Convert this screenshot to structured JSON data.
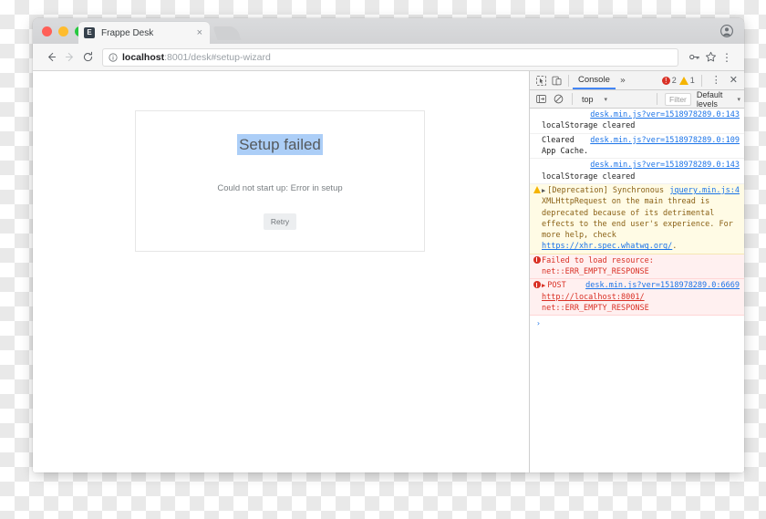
{
  "window": {
    "traffic_lights": [
      "close",
      "minimize",
      "maximize"
    ],
    "tab": {
      "favicon_letter": "E",
      "title": "Frappe Desk",
      "close_label": "×"
    },
    "toolbar": {
      "back_label": "←",
      "forward_label": "→",
      "reload_label": "↻",
      "omnibox_host": "localhost",
      "omnibox_rest": ":8001/desk#setup-wizard",
      "key_icon": "key-icon",
      "star_icon": "star-icon",
      "menu_label": "⋮"
    },
    "profile_icon": "profile-avatar-icon"
  },
  "page": {
    "title": "Setup failed",
    "message": "Could not start up: Error in setup",
    "retry_label": "Retry",
    "selection_color": "#accef7"
  },
  "devtools": {
    "tabbar": {
      "inspect_icon": "inspect-element-icon",
      "device_icon": "device-toolbar-icon",
      "tabs": [
        "Console"
      ],
      "active_tab": "Console",
      "more_label": "»",
      "error_count": "2",
      "warning_count": "1",
      "kebab_label": "⋮",
      "close_label": "✕"
    },
    "filterbar": {
      "sidebar_icon": "console-sidebar-icon",
      "clear_icon": "clear-console-icon",
      "context": "top",
      "filter_placeholder": "Filter",
      "levels": "Default levels",
      "caret": "▾"
    },
    "console": {
      "prompt": "›",
      "entries": [
        {
          "level": "log",
          "text": "localStorage cleared",
          "source": "desk.min.js?ver=1518978289.0:143"
        },
        {
          "level": "log",
          "text": "Cleared App Cache.",
          "source": "desk.min.js?ver=1518978289.0:109"
        },
        {
          "level": "log",
          "text": "localStorage cleared",
          "source": "desk.min.js?ver=1518978289.0:143"
        },
        {
          "level": "warn",
          "expandable": true,
          "text": "[Deprecation] Synchronous XMLHttpRequest on the main thread is deprecated because of its detrimental effects to the end user's experience. For more help, check ",
          "link": "https://xhr.spec.whatwg.org/",
          "text_after": ".",
          "source": "jquery.min.js:4"
        },
        {
          "level": "err",
          "text": "Failed to load resource: net::ERR_EMPTY_RESPONSE",
          "source": ""
        },
        {
          "level": "err",
          "expandable": true,
          "method": "POST ",
          "link": "http://localhost:8001/",
          "text_after": " net::ERR_EMPTY_RESPONSE",
          "source": "desk.min.js?ver=1518978289.0:6669"
        }
      ]
    }
  }
}
